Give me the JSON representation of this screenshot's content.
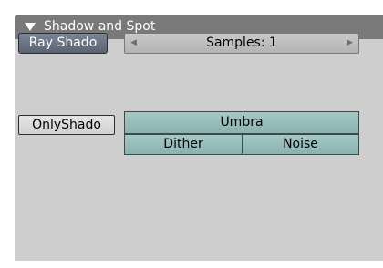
{
  "panel": {
    "title": "Shadow and Spot"
  },
  "buttons": {
    "ray_shadow": "Ray Shado",
    "samples": "Samples: 1",
    "only_shadow": "OnlyShado",
    "umbra": "Umbra",
    "dither": "Dither",
    "noise": "Noise"
  },
  "icons": {
    "collapse": "triangle-down-icon",
    "slider_left": "arrow-left-icon",
    "slider_right": "arrow-right-icon"
  },
  "colors": {
    "header": "#797979",
    "panel": "#cecece",
    "toggle_active": "#5b6373",
    "teal_button": "#9bbeba"
  },
  "state": {
    "ray_shadow_enabled": true,
    "only_shadow_enabled": false,
    "samples_value": 1
  }
}
